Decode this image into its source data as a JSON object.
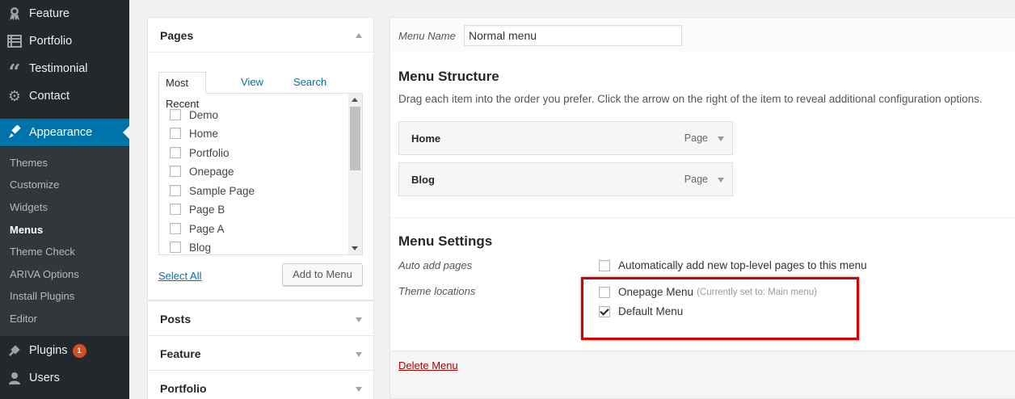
{
  "sidebar": {
    "top_items": [
      {
        "label": "Feature",
        "icon": "award-icon"
      },
      {
        "label": "Portfolio",
        "icon": "portfolio-icon"
      },
      {
        "label": "Testimonial",
        "icon": "quote-icon"
      },
      {
        "label": "Contact",
        "icon": "gear-icon"
      }
    ],
    "appearance": {
      "label": "Appearance",
      "icon": "paintbrush-icon"
    },
    "submenu": [
      "Themes",
      "Customize",
      "Widgets",
      "Menus",
      "Theme Check",
      "ARIVA Options",
      "Install Plugins",
      "Editor"
    ],
    "plugins": {
      "label": "Plugins",
      "icon": "plugin-icon",
      "badge": "1"
    },
    "users": {
      "label": "Users",
      "icon": "user-icon"
    },
    "colors": {
      "bg": "#23282d",
      "submenu_bg": "#32373c",
      "current": "#0073aa",
      "badge": "#d54e21"
    }
  },
  "pages_box": {
    "title": "Pages",
    "tabs": {
      "most_recent": "Most Recent",
      "view_all": "View All",
      "search": "Search"
    },
    "items": [
      "Demo",
      "Home",
      "Portfolio",
      "Onepage",
      "Sample Page",
      "Page B",
      "Page A",
      "Blog"
    ],
    "select_all": "Select All",
    "add_button": "Add to Menu"
  },
  "collapsed_boxes": [
    "Posts",
    "Feature",
    "Portfolio"
  ],
  "menu": {
    "name_label": "Menu Name",
    "name_value": "Normal menu",
    "structure_title": "Menu Structure",
    "structure_desc": "Drag each item into the order you prefer. Click the arrow on the right of the item to reveal additional configuration options.",
    "items": [
      {
        "title": "Home",
        "type": "Page"
      },
      {
        "title": "Blog",
        "type": "Page"
      }
    ],
    "settings_title": "Menu Settings",
    "auto_add_label": "Auto add pages",
    "auto_add_text": "Automatically add new top-level pages to this menu",
    "theme_locations_label": "Theme locations",
    "locations": [
      {
        "label": "Onepage Menu",
        "note": "(Currently set to: Main menu)",
        "checked": false
      },
      {
        "label": "Default Menu",
        "note": "",
        "checked": true
      }
    ],
    "delete_link": "Delete Menu",
    "highlight_color": "#d20000"
  }
}
